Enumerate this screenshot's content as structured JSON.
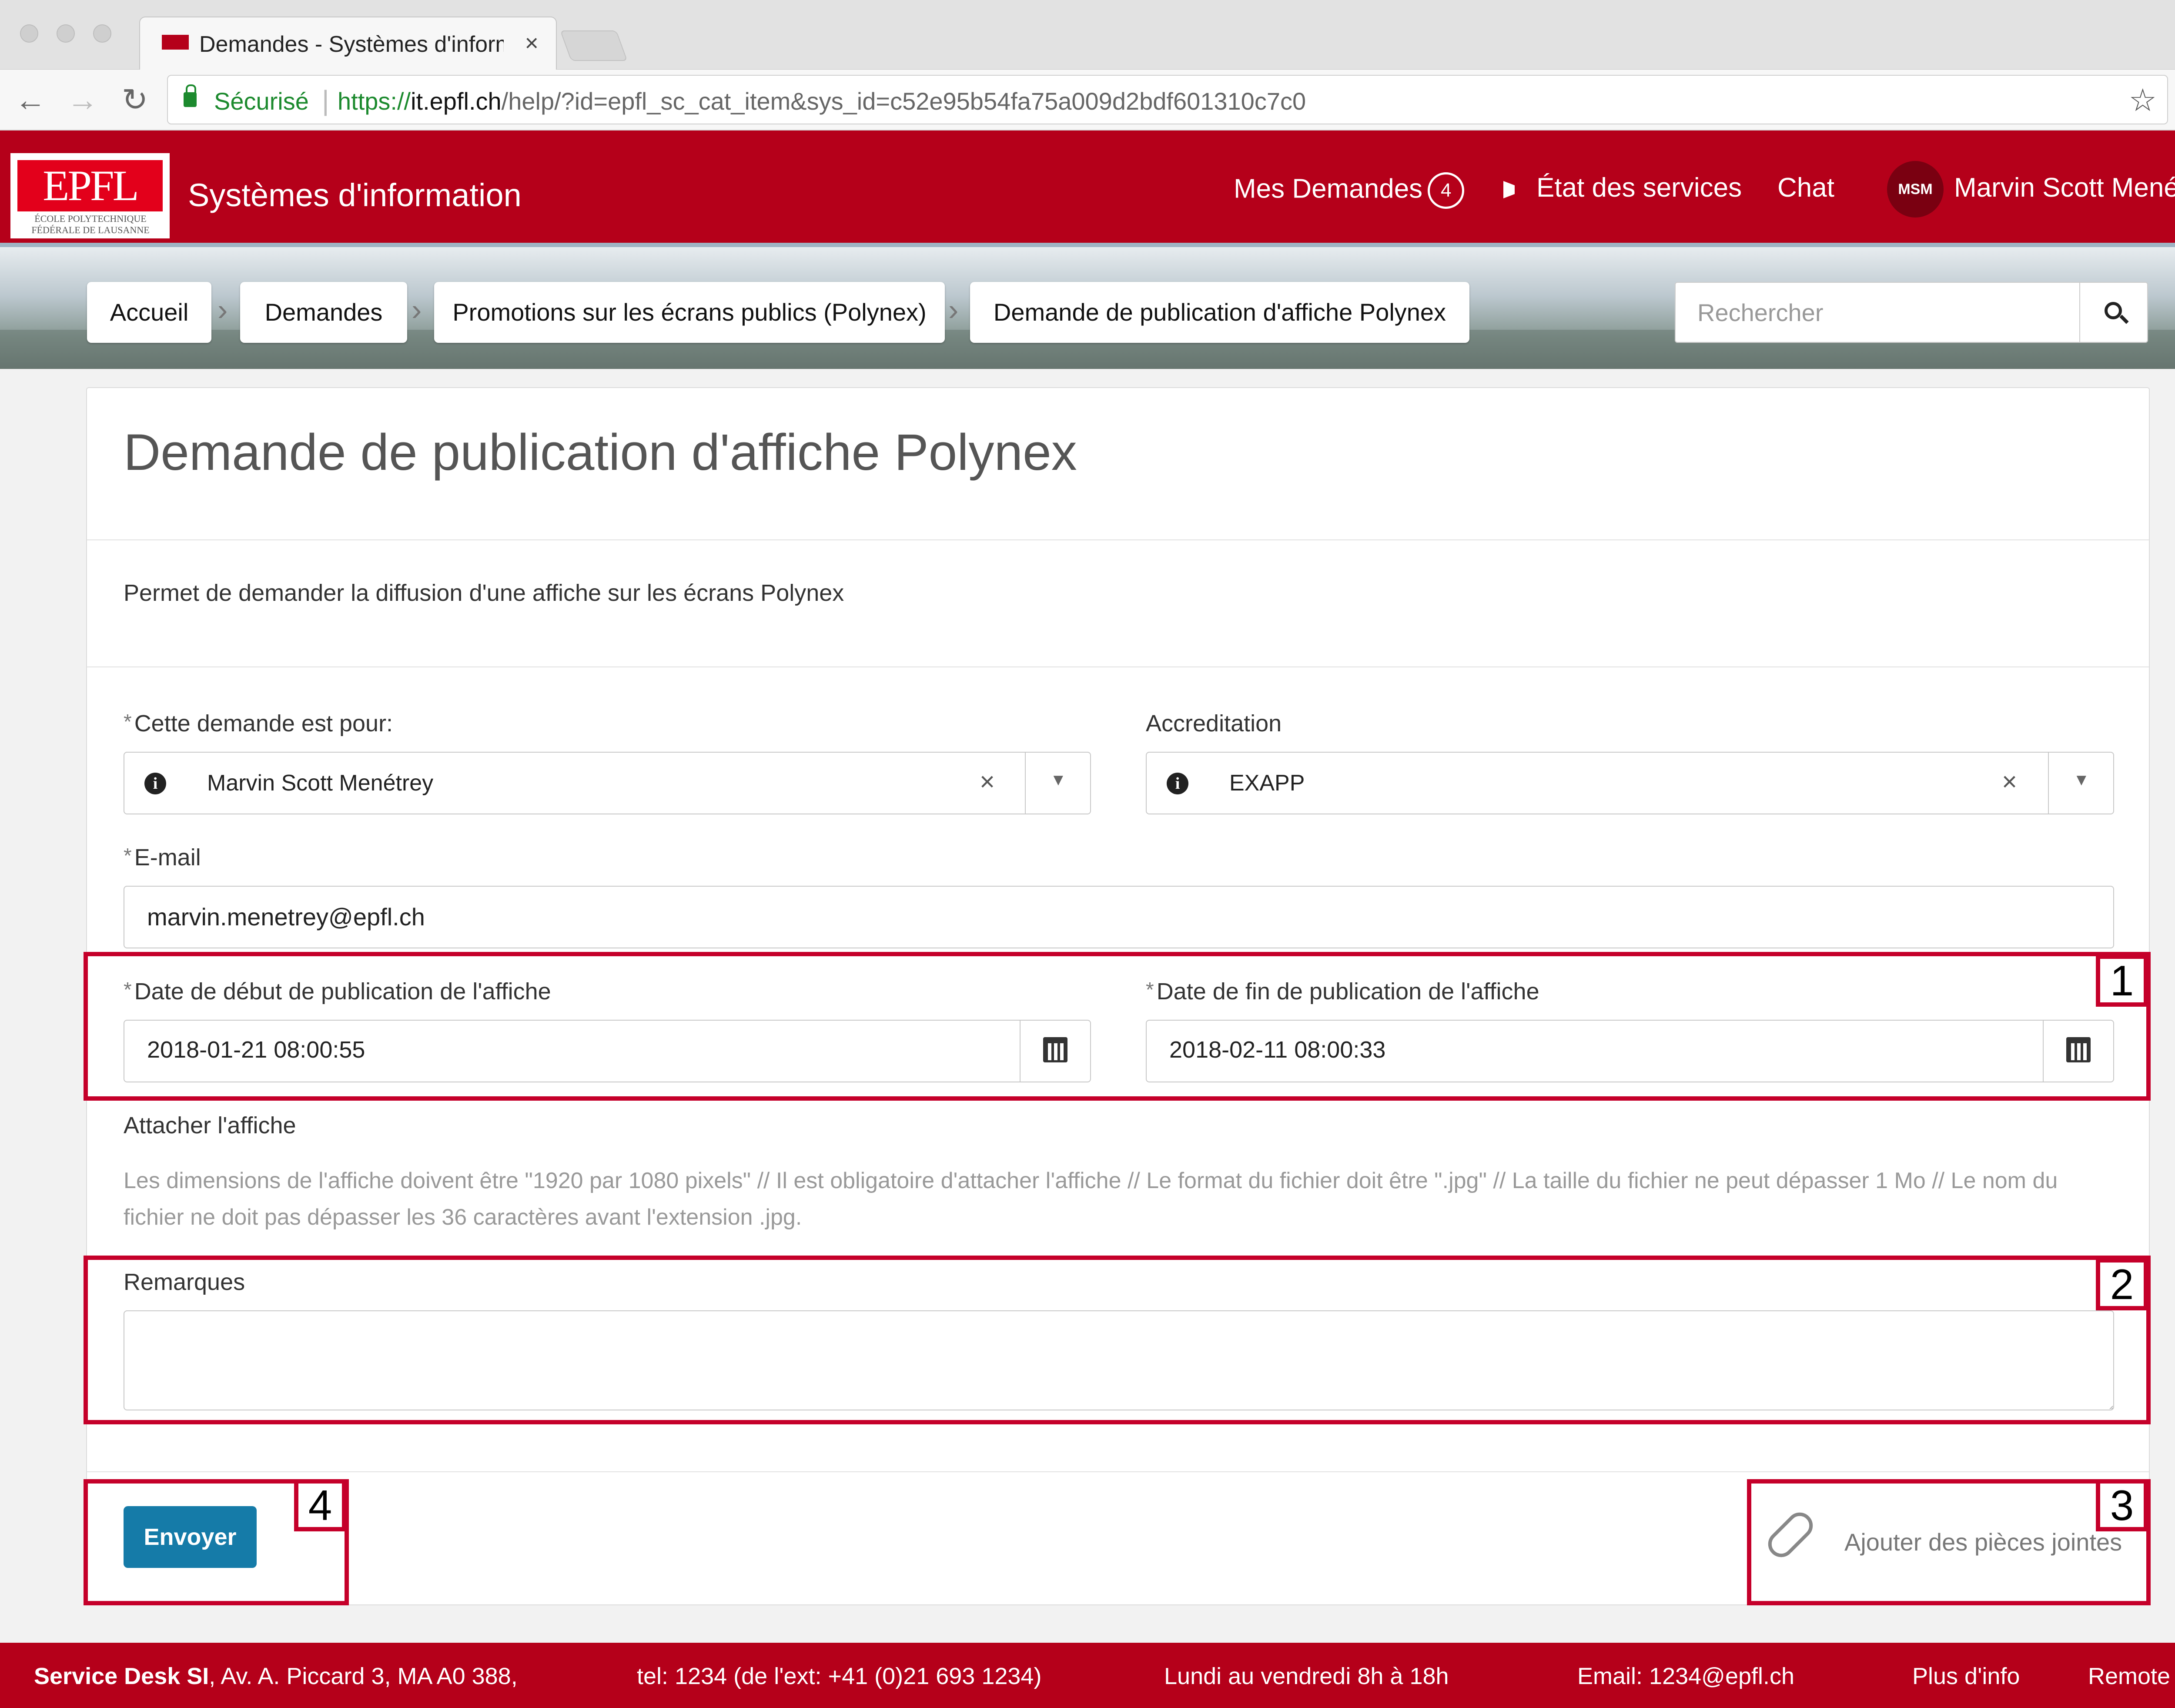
{
  "browser": {
    "tab_title": "Demandes - Systèmes d'inform",
    "close_glyph": "×",
    "secure_label": "Sécurisé",
    "url_proto": "https://",
    "url_host": "it.epfl.ch",
    "url_path": "/help/?id=epfl_sc_cat_item&sys_id=c52e95b54fa75a009d2bdf601310c7c0",
    "back_glyph": "←",
    "forward_glyph": "→",
    "reload_glyph": "↻",
    "star_glyph": "☆",
    "menu_glyph": "⋮"
  },
  "header": {
    "logo_text": "EPFL",
    "logo_subtext": "ÉCOLE POLYTECHNIQUE FÉDÉRALE DE LAUSANNE",
    "site_title": "Systèmes d'information",
    "nav": {
      "requests_label": "Mes Demandes",
      "requests_count": "4",
      "status_label": "État des services",
      "chat_label": "Chat",
      "user_initials": "MSM",
      "user_name": "Marvin Scott Menétrey"
    }
  },
  "breadcrumb": {
    "items": [
      "Accueil",
      "Demandes",
      "Promotions sur les écrans publics (Polynex)",
      "Demande de publication d'affiche Polynex"
    ],
    "separator": "›",
    "search_placeholder": "Rechercher"
  },
  "form": {
    "title": "Demande de publication d'affiche Polynex",
    "description": "Permet de demander la diffusion d'une affiche sur les écrans Polynex",
    "required_mark": "*",
    "requested_for": {
      "label": "Cette demande est pour:",
      "value": "Marvin Scott Menétrey"
    },
    "accreditation": {
      "label": "Accreditation",
      "value": "EXAPP"
    },
    "clear_glyph": "×",
    "dropdown_glyph": "▼",
    "info_glyph": "i",
    "email": {
      "label": "E-mail",
      "value": "marvin.menetrey@epfl.ch"
    },
    "start_date": {
      "label": "Date de début de publication de l'affiche",
      "value": "2018-01-21 08:00:55"
    },
    "end_date": {
      "label": "Date de fin de publication de l'affiche",
      "value": "2018-02-11 08:00:33"
    },
    "attach": {
      "label": "Attacher l'affiche",
      "help": "Les dimensions de l'affiche doivent être \"1920 par 1080 pixels\" // Il est obligatoire d'attacher l'affiche // Le format du fichier doit être \".jpg\" // La taille du fichier ne peut dépasser 1 Mo // Le nom du fichier ne doit pas dépasser les 36 caractères avant l'extension .jpg."
    },
    "remarks": {
      "label": "Remarques",
      "value": ""
    },
    "submit_label": "Envoyer",
    "attachments_label": "Ajouter des pièces jointes"
  },
  "annotations": [
    "1",
    "2",
    "3",
    "4"
  ],
  "footer": {
    "service_desk_bold": "Service Desk SI",
    "address": ", Av. A. Piccard 3, MA A0 388,",
    "phone": "tel: 1234 (de l'ext: +41 (0)21 693 1234)",
    "hours": "Lundi au vendredi 8h à 18h",
    "email": "Email: 1234@epfl.ch",
    "more_info": "Plus d'info",
    "remote": "Remote contr"
  }
}
